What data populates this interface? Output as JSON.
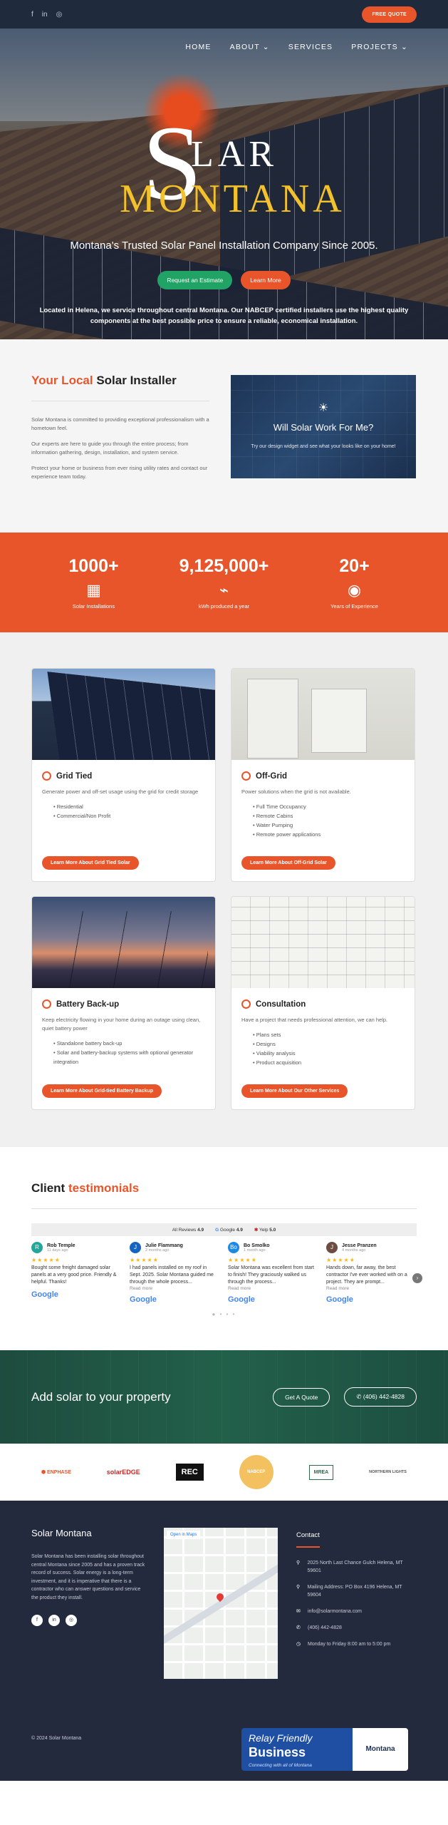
{
  "topbar": {
    "quote_btn": "FREE QUOTE",
    "socials": [
      "f",
      "in",
      "◎"
    ]
  },
  "nav": [
    "HOME",
    "ABOUT ⌄",
    "SERVICES",
    "PROJECTS ⌄"
  ],
  "hero": {
    "logo_s": "S",
    "logo_lar": "LAR",
    "logo_montana": "MONTANA",
    "subtitle": "Montana's Trusted Solar Panel Installation Company Since 2005.",
    "btn_estimate": "Request an Estimate",
    "btn_learn": "Learn More",
    "note": "Located in Helena, we service throughout central Montana. Our NABCEP certified installers use the highest quality components at the best possible price to ensure a reliable, economical installation."
  },
  "installer": {
    "title_accent": "Your Local",
    "title_rest": "Solar Installer",
    "paragraphs": [
      "Solar Montana is committed to providing exceptional professionalism with a hometown feel.",
      "Our experts are here to guide you through the entire process; from information gathering, design, installation, and system service.",
      "Protect your home or business from ever rising utility rates and contact our experience team today."
    ],
    "card_title": "Will Solar Work For Me?",
    "card_text": "Try our design widget and see what your looks like on your home!"
  },
  "stats": [
    {
      "num": "1000+",
      "icon": "▦",
      "icon_name": "solar-panel-icon",
      "label": "Solar Installations"
    },
    {
      "num": "9,125,000+",
      "icon": "⌁",
      "icon_name": "battery-icon",
      "label": "kWh produced a year"
    },
    {
      "num": "20+",
      "icon": "◉",
      "icon_name": "worker-icon",
      "label": "Years of Experience"
    }
  ],
  "services": [
    {
      "img": "img-grid",
      "title": "Grid Tied",
      "desc": "Generate power and off-set usage using the grid for credit storage",
      "items": [
        "Residential",
        "Commercial/Non Profit"
      ],
      "btn": "Learn More About Grid Tied Solar"
    },
    {
      "img": "img-off",
      "title": "Off-Grid",
      "desc": "Power solutions when the grid is not available.",
      "items": [
        "Full Time Occupancy",
        "Remote Cabins",
        "Water Pumping",
        "Remote power applications"
      ],
      "btn": "Learn More About Off-Grid Solar"
    },
    {
      "img": "img-batt",
      "title": "Battery Back-up",
      "desc": "Keep electricity flowing in your home during an outage using clean, quiet battery power",
      "items": [
        "Standalone battery back-up",
        "Solar and battery-backup systems with optional generator integration"
      ],
      "btn": "Learn More About Grid-tied Battery Backup"
    },
    {
      "img": "img-cons",
      "title": "Consultation",
      "desc": "Have a project that needs professional attention, we can help.",
      "items": [
        "Plans sets",
        "Designs",
        "Viability analysis",
        "Product acquisition"
      ],
      "btn": "Learn More About Our Other Services"
    }
  ],
  "testimonials": {
    "title_rest": "Client",
    "title_accent": "testimonials",
    "all_reviews": "All Reviews",
    "all_score": "4.9",
    "google": "Google",
    "google_score": "4.9",
    "yelp": "Yelp",
    "yelp_score": "5.0",
    "stars": "★★★★★",
    "read_more": "Read more",
    "google_mark": "Google",
    "reviews": [
      {
        "initial": "R",
        "color": "#26a69a",
        "name": "Rob Temple",
        "ago": "11 days ago",
        "text": "Bought some freight damaged solar panels at a very good price. Friendly & helpful. Thanks!"
      },
      {
        "initial": "J",
        "color": "#1565c0",
        "name": "Julie Flammang",
        "ago": "2 months ago",
        "text": "I had panels installed on my roof in Sept. 2025. Solar Montana guided me through the whole process..."
      },
      {
        "initial": "Bo",
        "color": "#1e88e5",
        "name": "Bo Smolko",
        "ago": "1 month ago",
        "text": "Solar Montana was excellent from start to finish! They graciously walked us through the process..."
      },
      {
        "initial": "J",
        "color": "#6d4c41",
        "name": "Jesse Pranzen",
        "ago": "4 months ago",
        "text": "Hands down, far away, the best contractor I've ever worked with on a project. They are prompt..."
      }
    ]
  },
  "cta": {
    "title": "Add solar to your property",
    "quote": "Get A Quote",
    "phone": "✆  (406) 442-4828"
  },
  "partners": [
    "⬢ ENPHASE",
    "solarEDGE",
    "REC",
    "NABCEP",
    "MREA",
    "NORTHERN LIGHTS"
  ],
  "footer": {
    "title": "Solar Montana",
    "about": "Solar Montana has been installing solar throughout central Montana since 2005 and has a proven track record of success. Solar energy is a long-term investment, and it is imperative that there is a contractor who can answer questions and service the product they install.",
    "socials": [
      "f",
      "in",
      "◎"
    ],
    "map_open": "Open in Maps",
    "contact_title": "Contact",
    "contact": [
      {
        "icon": "⚲",
        "text": "2025 North Last Chance Gulch Helena, MT 59601"
      },
      {
        "icon": "⚲",
        "text": "Mailing Address: PO Box 4196 Helena, MT 59604"
      },
      {
        "icon": "✉",
        "text": "info@solarmontana.com"
      },
      {
        "icon": "✆",
        "text": "(406) 442-4828"
      },
      {
        "icon": "◷",
        "text": "Monday to Friday 8:00 am to 5:00 pm"
      }
    ],
    "copyright": "© 2024 Solar Montana",
    "relay_1": "Relay Friendly",
    "relay_2": "Business",
    "relay_3": "Connecting with all of Montana",
    "relay_montana": "Montana"
  }
}
